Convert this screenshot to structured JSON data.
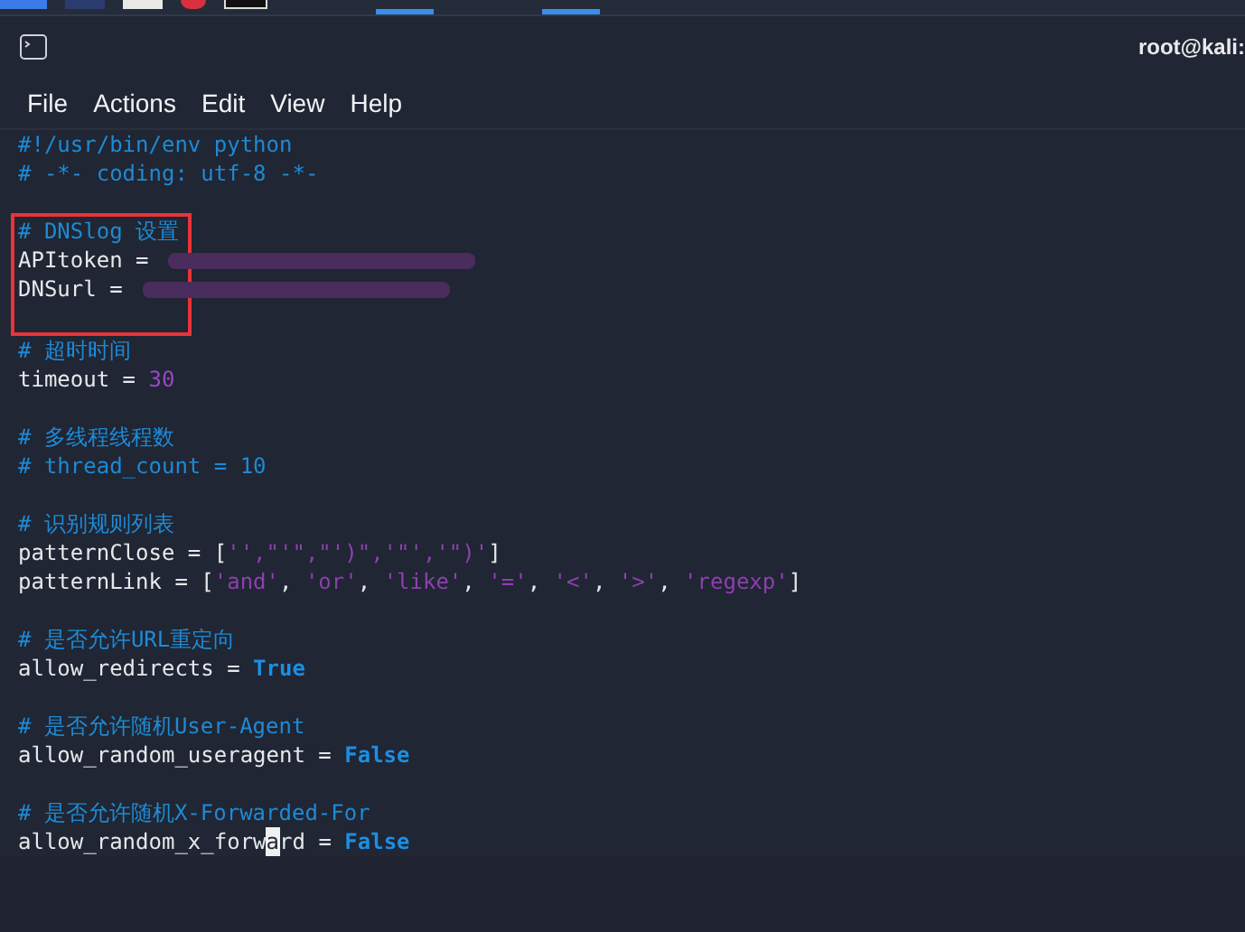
{
  "window": {
    "title": "root@kali:"
  },
  "menu": [
    {
      "label": "File"
    },
    {
      "label": "Actions"
    },
    {
      "label": "Edit"
    },
    {
      "label": "View"
    },
    {
      "label": "Help"
    }
  ],
  "code_blocks": [
    {
      "boxed": false,
      "lines": [
        [
          {
            "kind": "comment",
            "text": "#!/usr/bin/env python"
          }
        ],
        [
          {
            "kind": "comment",
            "text": "# -*- coding: utf-8 -*-"
          }
        ]
      ]
    },
    {
      "boxed": true,
      "lines": [
        [
          {
            "kind": "comment",
            "text": "# DNSlog 设置"
          }
        ],
        [
          {
            "kind": "name",
            "text": "APItoken = "
          },
          {
            "kind": "redacted"
          }
        ],
        [
          {
            "kind": "name",
            "text": "DNSurl = "
          },
          {
            "kind": "redacted"
          }
        ]
      ]
    },
    {
      "boxed": false,
      "lines": [
        [
          {
            "kind": "comment",
            "text": "# 超时时间"
          }
        ],
        [
          {
            "kind": "name",
            "text": "timeout = "
          },
          {
            "kind": "number",
            "text": "30"
          }
        ]
      ]
    },
    {
      "boxed": false,
      "lines": [
        [
          {
            "kind": "comment",
            "text": "# 多线程线程数"
          }
        ],
        [
          {
            "kind": "comment",
            "text": "# thread_count = 10"
          }
        ]
      ]
    },
    {
      "boxed": false,
      "lines": [
        [
          {
            "kind": "comment",
            "text": "# 识别规则列表"
          }
        ],
        [
          {
            "kind": "name",
            "text": "patternClose = ["
          },
          {
            "kind": "string",
            "text": "'',\"'\",\"')\",'\"','\")'"
          },
          {
            "kind": "name",
            "text": "]"
          }
        ],
        [
          {
            "kind": "name",
            "text": "patternLink = ["
          },
          {
            "kind": "string",
            "text": "'and'"
          },
          {
            "kind": "name",
            "text": ", "
          },
          {
            "kind": "string",
            "text": "'or'"
          },
          {
            "kind": "name",
            "text": ", "
          },
          {
            "kind": "string",
            "text": "'like'"
          },
          {
            "kind": "name",
            "text": ", "
          },
          {
            "kind": "string",
            "text": "'='"
          },
          {
            "kind": "name",
            "text": ", "
          },
          {
            "kind": "string",
            "text": "'<'"
          },
          {
            "kind": "name",
            "text": ", "
          },
          {
            "kind": "string",
            "text": "'>'"
          },
          {
            "kind": "name",
            "text": ", "
          },
          {
            "kind": "string",
            "text": "'regexp'"
          },
          {
            "kind": "name",
            "text": "]"
          }
        ]
      ]
    },
    {
      "boxed": false,
      "lines": [
        [
          {
            "kind": "comment",
            "text": "# 是否允许URL重定向"
          }
        ],
        [
          {
            "kind": "name",
            "text": "allow_redirects = "
          },
          {
            "kind": "keyword",
            "text": "True"
          }
        ]
      ]
    },
    {
      "boxed": false,
      "lines": [
        [
          {
            "kind": "comment",
            "text": "# 是否允许随机User-Agent"
          }
        ],
        [
          {
            "kind": "name",
            "text": "allow_random_useragent = "
          },
          {
            "kind": "keyword",
            "text": "False"
          }
        ]
      ]
    },
    {
      "boxed": false,
      "lines": [
        [
          {
            "kind": "comment",
            "text": "# 是否允许随机X-Forwarded-For"
          }
        ],
        [
          {
            "kind": "name",
            "text": "allow_random_x_forw"
          },
          {
            "kind": "cursor",
            "text": "a"
          },
          {
            "kind": "name",
            "text": "rd = "
          },
          {
            "kind": "keyword",
            "text": "False"
          }
        ]
      ]
    }
  ]
}
